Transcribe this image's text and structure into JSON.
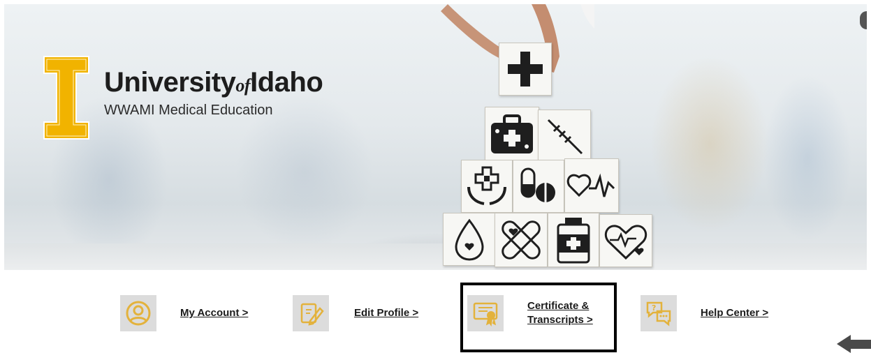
{
  "hero": {
    "logo": {
      "name_main": "University",
      "name_of": "of",
      "name_end": "Idaho",
      "subtitle": "WWAMI Medical Education",
      "brand_color": "#f1b300"
    },
    "block_icons": [
      "plus-cross-icon",
      "first-aid-kit-icon",
      "syringe-icon",
      "hands-holding-cross-icon",
      "pills-icon",
      "heartbeat-icon",
      "blood-drop-icon",
      "bandage-icon",
      "medicine-bottle-icon",
      "heart-pulse-icon"
    ]
  },
  "nav": {
    "items": [
      {
        "id": "my-account",
        "label_line1": "My Account >",
        "label_line2": "",
        "icon": "user-circle-icon"
      },
      {
        "id": "edit-profile",
        "label_line1": "Edit Profile >",
        "label_line2": "",
        "icon": "edit-pencil-icon"
      },
      {
        "id": "certificate-transcripts",
        "label_line1": "Certificate &",
        "label_line2": "Transcripts >",
        "icon": "certificate-icon"
      },
      {
        "id": "help-center",
        "label_line1": "Help Center >",
        "label_line2": "",
        "icon": "help-chat-icon"
      }
    ],
    "highlighted": "certificate-transcripts",
    "icon_color": "#e3b23c"
  }
}
